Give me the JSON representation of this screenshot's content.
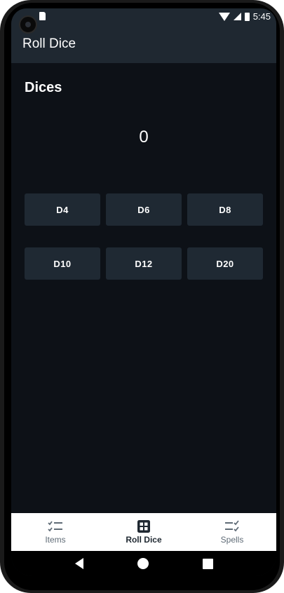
{
  "status_bar": {
    "time": "5:45",
    "icons": [
      "notification-icon",
      "sim-icon",
      "wifi-icon",
      "signal-icon",
      "battery-icon"
    ]
  },
  "app_bar": {
    "title": "Roll Dice"
  },
  "main": {
    "section_title": "Dices",
    "result": "0",
    "dice_buttons": [
      {
        "label": "D4"
      },
      {
        "label": "D6"
      },
      {
        "label": "D8"
      },
      {
        "label": "D10"
      },
      {
        "label": "D12"
      },
      {
        "label": "D20"
      }
    ]
  },
  "bottom_nav": {
    "items": [
      {
        "label": "Items",
        "icon": "checklist-icon",
        "active": false
      },
      {
        "label": "Roll Dice",
        "icon": "dice-icon",
        "active": true
      },
      {
        "label": "Spells",
        "icon": "spell-list-icon",
        "active": false
      }
    ]
  },
  "colors": {
    "background": "#0d1117",
    "app_bar": "#1f2831",
    "button": "#1f2933",
    "nav_background": "#ffffff",
    "nav_active": "#1f2831",
    "nav_inactive": "#5f6b76"
  }
}
